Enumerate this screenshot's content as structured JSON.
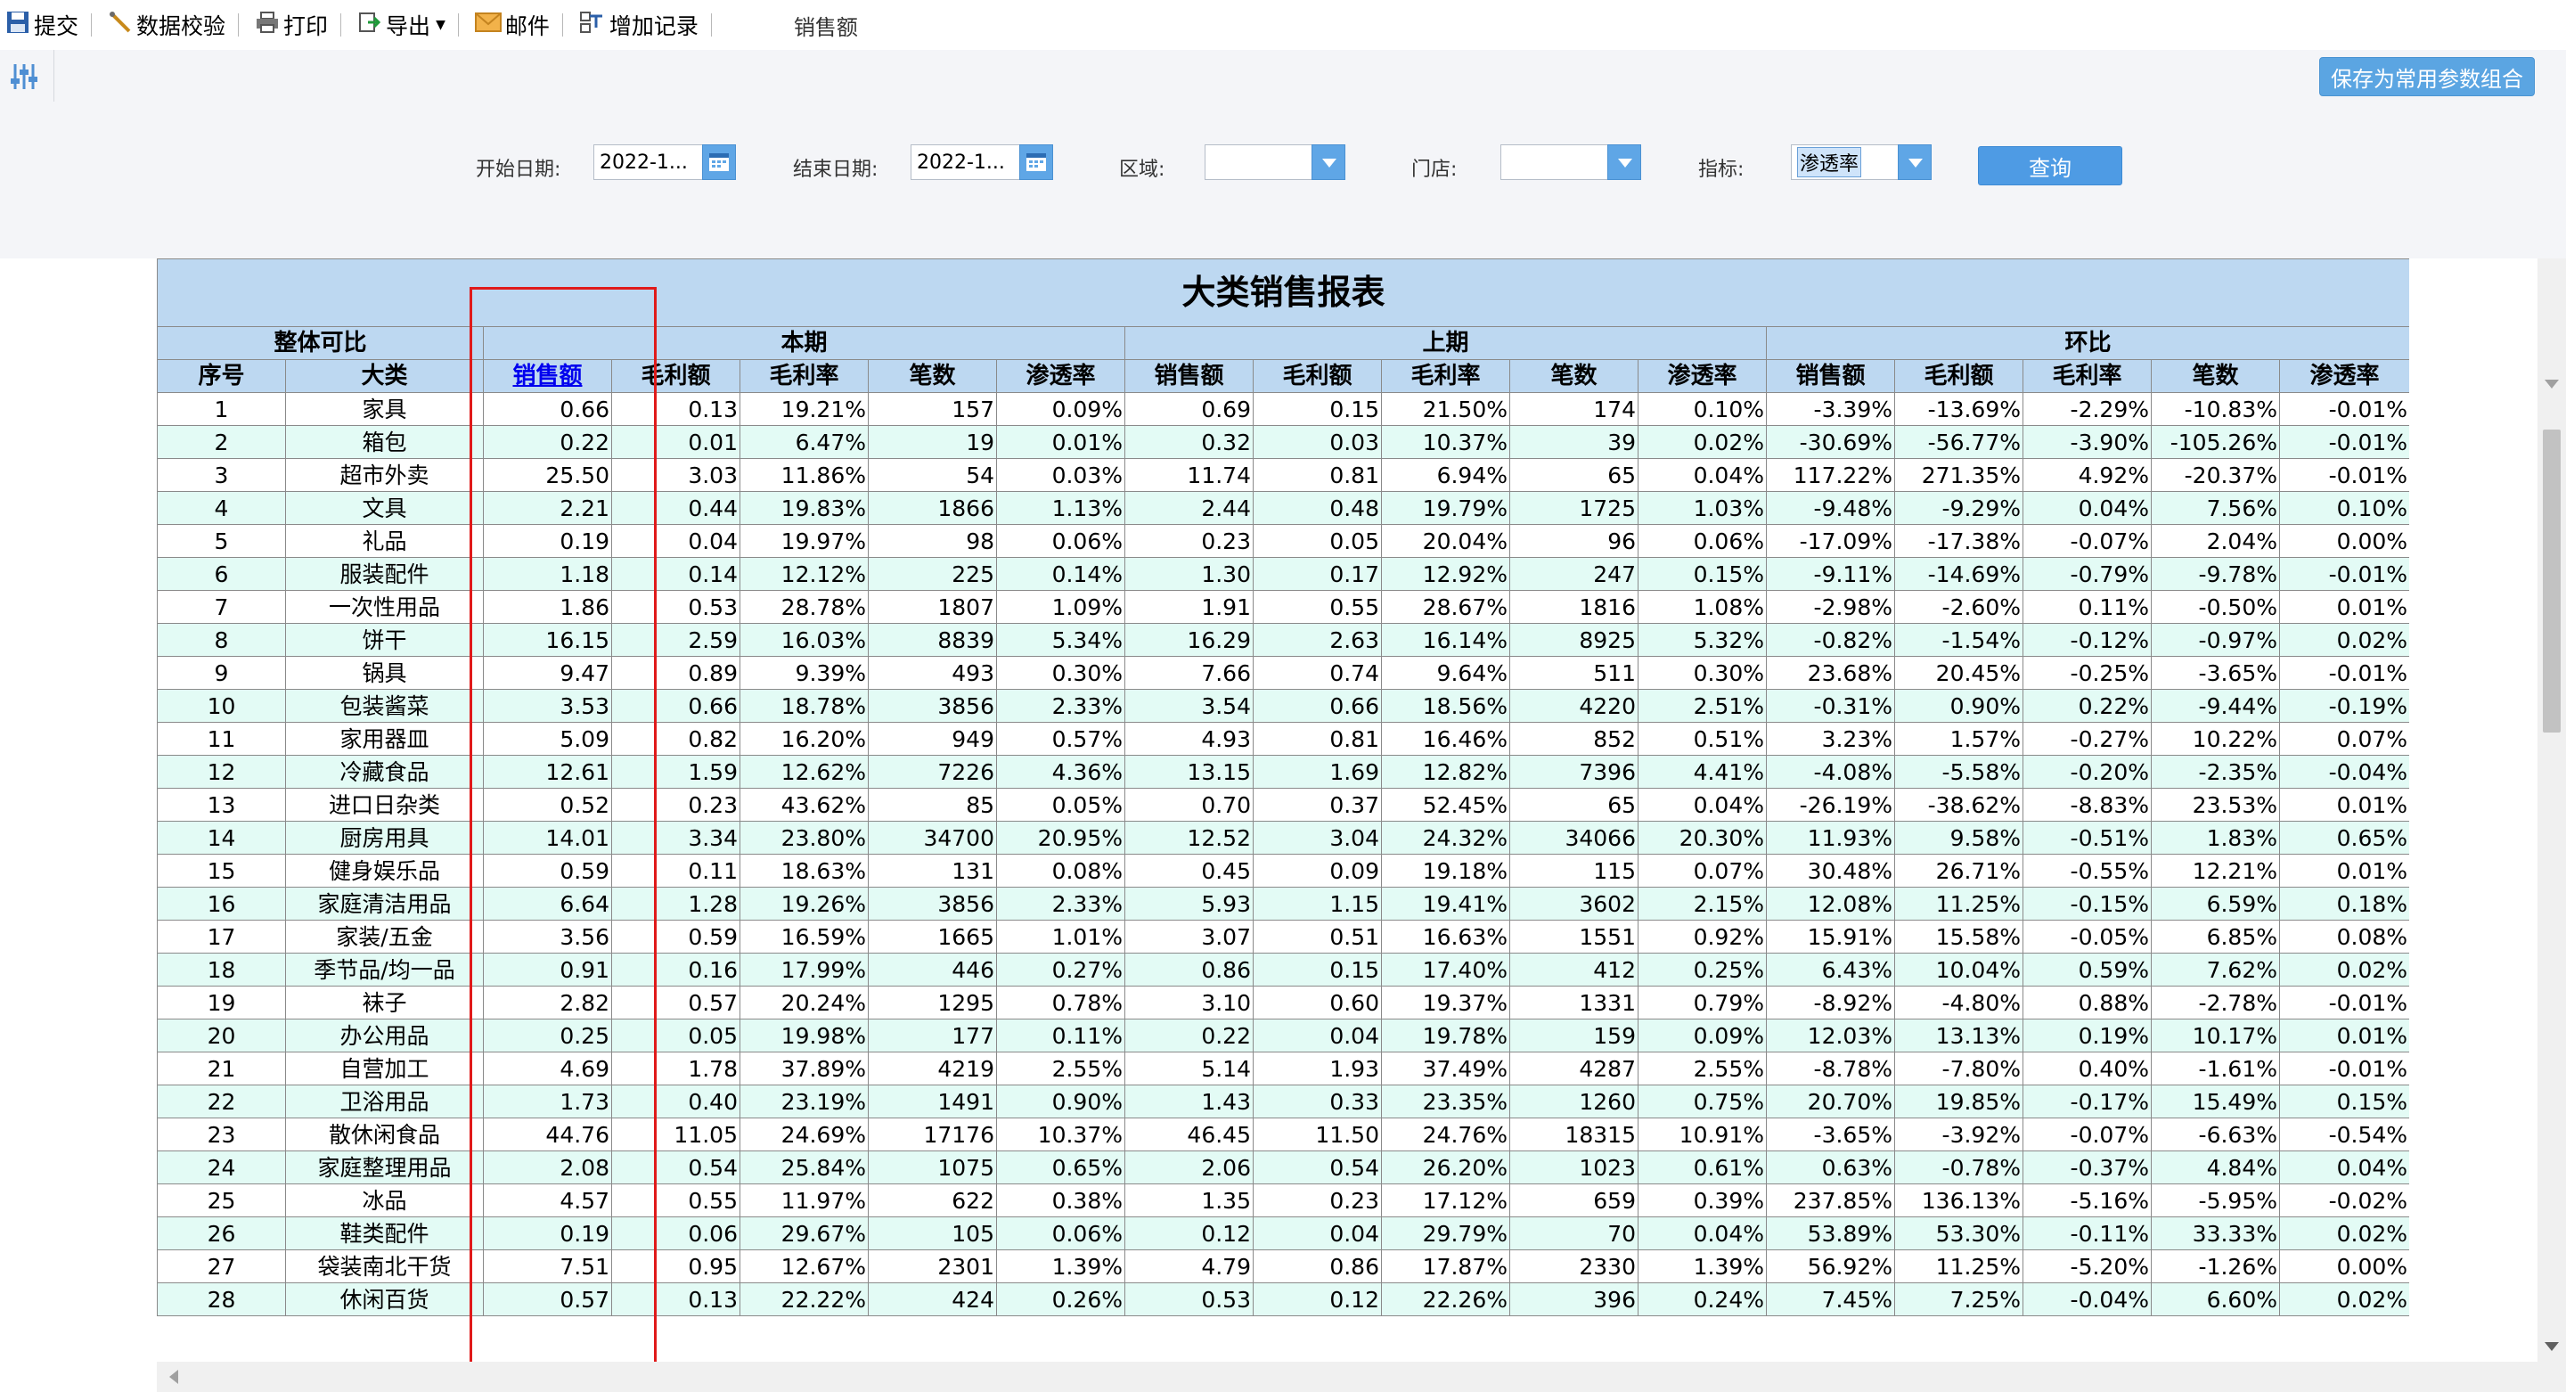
{
  "toolbar": {
    "submit": "提交",
    "validate": "数据校验",
    "print": "打印",
    "export": "导出",
    "mail": "邮件",
    "add_record": "增加记录",
    "current_metric": "销售额"
  },
  "params": {
    "save_combo": "保存为常用参数组合"
  },
  "filters": {
    "start_label": "开始日期:",
    "start_value": "2022-1...",
    "end_label": "结束日期:",
    "end_value": "2022-1...",
    "region_label": "区域:",
    "region_value": "",
    "store_label": "门店:",
    "store_value": "",
    "metric_label": "指标:",
    "metric_value": "渗透率",
    "query": "查询"
  },
  "report": {
    "title": "大类销售报表",
    "group_overall": "整体可比",
    "group_current": "本期",
    "group_previous": "上期",
    "group_ratio": "环比",
    "col_index": "序号",
    "col_category": "大类",
    "col_sales": "销售额",
    "col_gross_profit": "毛利额",
    "col_margin": "毛利率",
    "col_count": "笔数",
    "col_penetration": "渗透率",
    "rows": [
      [
        "1",
        "家具",
        "0.66",
        "0.13",
        "19.21%",
        "157",
        "0.09%",
        "0.69",
        "0.15",
        "21.50%",
        "174",
        "0.10%",
        "-3.39%",
        "-13.69%",
        "-2.29%",
        "-10.83%",
        "-0.01%"
      ],
      [
        "2",
        "箱包",
        "0.22",
        "0.01",
        "6.47%",
        "19",
        "0.01%",
        "0.32",
        "0.03",
        "10.37%",
        "39",
        "0.02%",
        "-30.69%",
        "-56.77%",
        "-3.90%",
        "-105.26%",
        "-0.01%"
      ],
      [
        "3",
        "超市外卖",
        "25.50",
        "3.03",
        "11.86%",
        "54",
        "0.03%",
        "11.74",
        "0.81",
        "6.94%",
        "65",
        "0.04%",
        "117.22%",
        "271.35%",
        "4.92%",
        "-20.37%",
        "-0.01%"
      ],
      [
        "4",
        "文具",
        "2.21",
        "0.44",
        "19.83%",
        "1866",
        "1.13%",
        "2.44",
        "0.48",
        "19.79%",
        "1725",
        "1.03%",
        "-9.48%",
        "-9.29%",
        "0.04%",
        "7.56%",
        "0.10%"
      ],
      [
        "5",
        "礼品",
        "0.19",
        "0.04",
        "19.97%",
        "98",
        "0.06%",
        "0.23",
        "0.05",
        "20.04%",
        "96",
        "0.06%",
        "-17.09%",
        "-17.38%",
        "-0.07%",
        "2.04%",
        "0.00%"
      ],
      [
        "6",
        "服装配件",
        "1.18",
        "0.14",
        "12.12%",
        "225",
        "0.14%",
        "1.30",
        "0.17",
        "12.92%",
        "247",
        "0.15%",
        "-9.11%",
        "-14.69%",
        "-0.79%",
        "-9.78%",
        "-0.01%"
      ],
      [
        "7",
        "一次性用品",
        "1.86",
        "0.53",
        "28.78%",
        "1807",
        "1.09%",
        "1.91",
        "0.55",
        "28.67%",
        "1816",
        "1.08%",
        "-2.98%",
        "-2.60%",
        "0.11%",
        "-0.50%",
        "0.01%"
      ],
      [
        "8",
        "饼干",
        "16.15",
        "2.59",
        "16.03%",
        "8839",
        "5.34%",
        "16.29",
        "2.63",
        "16.14%",
        "8925",
        "5.32%",
        "-0.82%",
        "-1.54%",
        "-0.12%",
        "-0.97%",
        "0.02%"
      ],
      [
        "9",
        "锅具",
        "9.47",
        "0.89",
        "9.39%",
        "493",
        "0.30%",
        "7.66",
        "0.74",
        "9.64%",
        "511",
        "0.30%",
        "23.68%",
        "20.45%",
        "-0.25%",
        "-3.65%",
        "-0.01%"
      ],
      [
        "10",
        "包装酱菜",
        "3.53",
        "0.66",
        "18.78%",
        "3856",
        "2.33%",
        "3.54",
        "0.66",
        "18.56%",
        "4220",
        "2.51%",
        "-0.31%",
        "0.90%",
        "0.22%",
        "-9.44%",
        "-0.19%"
      ],
      [
        "11",
        "家用器皿",
        "5.09",
        "0.82",
        "16.20%",
        "949",
        "0.57%",
        "4.93",
        "0.81",
        "16.46%",
        "852",
        "0.51%",
        "3.23%",
        "1.57%",
        "-0.27%",
        "10.22%",
        "0.07%"
      ],
      [
        "12",
        "冷藏食品",
        "12.61",
        "1.59",
        "12.62%",
        "7226",
        "4.36%",
        "13.15",
        "1.69",
        "12.82%",
        "7396",
        "4.41%",
        "-4.08%",
        "-5.58%",
        "-0.20%",
        "-2.35%",
        "-0.04%"
      ],
      [
        "13",
        "进口日杂类",
        "0.52",
        "0.23",
        "43.62%",
        "85",
        "0.05%",
        "0.70",
        "0.37",
        "52.45%",
        "65",
        "0.04%",
        "-26.19%",
        "-38.62%",
        "-8.83%",
        "23.53%",
        "0.01%"
      ],
      [
        "14",
        "厨房用具",
        "14.01",
        "3.34",
        "23.80%",
        "34700",
        "20.95%",
        "12.52",
        "3.04",
        "24.32%",
        "34066",
        "20.30%",
        "11.93%",
        "9.58%",
        "-0.51%",
        "1.83%",
        "0.65%"
      ],
      [
        "15",
        "健身娱乐品",
        "0.59",
        "0.11",
        "18.63%",
        "131",
        "0.08%",
        "0.45",
        "0.09",
        "19.18%",
        "115",
        "0.07%",
        "30.48%",
        "26.71%",
        "-0.55%",
        "12.21%",
        "0.01%"
      ],
      [
        "16",
        "家庭清洁用品",
        "6.64",
        "1.28",
        "19.26%",
        "3856",
        "2.33%",
        "5.93",
        "1.15",
        "19.41%",
        "3602",
        "2.15%",
        "12.08%",
        "11.25%",
        "-0.15%",
        "6.59%",
        "0.18%"
      ],
      [
        "17",
        "家装/五金",
        "3.56",
        "0.59",
        "16.59%",
        "1665",
        "1.01%",
        "3.07",
        "0.51",
        "16.63%",
        "1551",
        "0.92%",
        "15.91%",
        "15.58%",
        "-0.05%",
        "6.85%",
        "0.08%"
      ],
      [
        "18",
        "季节品/均一品",
        "0.91",
        "0.16",
        "17.99%",
        "446",
        "0.27%",
        "0.86",
        "0.15",
        "17.40%",
        "412",
        "0.25%",
        "6.43%",
        "10.04%",
        "0.59%",
        "7.62%",
        "0.02%"
      ],
      [
        "19",
        "袜子",
        "2.82",
        "0.57",
        "20.24%",
        "1295",
        "0.78%",
        "3.10",
        "0.60",
        "19.37%",
        "1331",
        "0.79%",
        "-8.92%",
        "-4.80%",
        "0.88%",
        "-2.78%",
        "-0.01%"
      ],
      [
        "20",
        "办公用品",
        "0.25",
        "0.05",
        "19.98%",
        "177",
        "0.11%",
        "0.22",
        "0.04",
        "19.78%",
        "159",
        "0.09%",
        "12.03%",
        "13.13%",
        "0.19%",
        "10.17%",
        "0.01%"
      ],
      [
        "21",
        "自营加工",
        "4.69",
        "1.78",
        "37.89%",
        "4219",
        "2.55%",
        "5.14",
        "1.93",
        "37.49%",
        "4287",
        "2.55%",
        "-8.78%",
        "-7.80%",
        "0.40%",
        "-1.61%",
        "-0.01%"
      ],
      [
        "22",
        "卫浴用品",
        "1.73",
        "0.40",
        "23.19%",
        "1491",
        "0.90%",
        "1.43",
        "0.33",
        "23.35%",
        "1260",
        "0.75%",
        "20.70%",
        "19.85%",
        "-0.17%",
        "15.49%",
        "0.15%"
      ],
      [
        "23",
        "散休闲食品",
        "44.76",
        "11.05",
        "24.69%",
        "17176",
        "10.37%",
        "46.45",
        "11.50",
        "24.76%",
        "18315",
        "10.91%",
        "-3.65%",
        "-3.92%",
        "-0.07%",
        "-6.63%",
        "-0.54%"
      ],
      [
        "24",
        "家庭整理用品",
        "2.08",
        "0.54",
        "25.84%",
        "1075",
        "0.65%",
        "2.06",
        "0.54",
        "26.20%",
        "1023",
        "0.61%",
        "0.63%",
        "-0.78%",
        "-0.37%",
        "4.84%",
        "0.04%"
      ],
      [
        "25",
        "冰品",
        "4.57",
        "0.55",
        "11.97%",
        "622",
        "0.38%",
        "1.35",
        "0.23",
        "17.12%",
        "659",
        "0.39%",
        "237.85%",
        "136.13%",
        "-5.16%",
        "-5.95%",
        "-0.02%"
      ],
      [
        "26",
        "鞋类配件",
        "0.19",
        "0.06",
        "29.67%",
        "105",
        "0.06%",
        "0.12",
        "0.04",
        "29.79%",
        "70",
        "0.04%",
        "53.89%",
        "53.30%",
        "-0.11%",
        "33.33%",
        "0.02%"
      ],
      [
        "27",
        "袋装南北干货",
        "7.51",
        "0.95",
        "12.67%",
        "2301",
        "1.39%",
        "4.79",
        "0.86",
        "17.87%",
        "2330",
        "1.39%",
        "56.92%",
        "11.25%",
        "-5.20%",
        "-1.26%",
        "0.00%"
      ],
      [
        "28",
        "休闲百货",
        "0.57",
        "0.13",
        "22.22%",
        "424",
        "0.26%",
        "0.53",
        "0.12",
        "22.26%",
        "396",
        "0.24%",
        "7.45%",
        "7.25%",
        "-0.04%",
        "6.60%",
        "0.02%"
      ]
    ]
  },
  "colors": {
    "header_bg": "#bdd8f1",
    "row_alt_bg": "#e3fbf5",
    "highlight_box": "#e01a1a",
    "button_blue": "#4e9be4"
  }
}
